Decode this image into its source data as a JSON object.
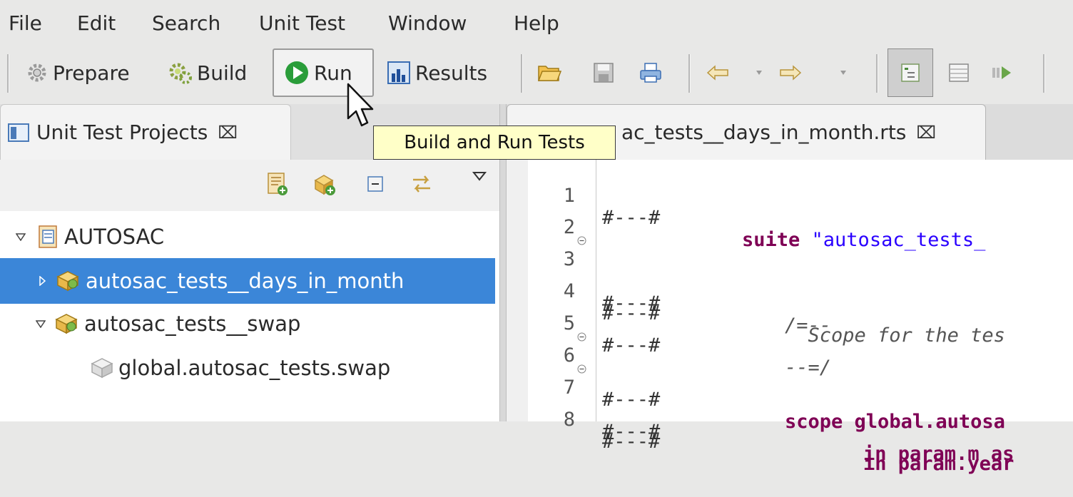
{
  "menubar": {
    "items": [
      "File",
      "Edit",
      "Search",
      "Unit Test",
      "Window",
      "Help"
    ]
  },
  "toolbar": {
    "prepare_label": "Prepare",
    "build_label": "Build",
    "run_label": "Run",
    "results_label": "Results",
    "run_color": "#2a9d3a"
  },
  "tooltip": {
    "text": "Build and Run Tests"
  },
  "left_view": {
    "tab_label": "Unit Test Projects",
    "tree": [
      {
        "label": "AUTOSAC",
        "expanded": true,
        "selected": false
      },
      {
        "label": "autosac_tests__days_in_month",
        "expanded": false,
        "selected": true
      },
      {
        "label": "autosac_tests__swap",
        "expanded": true,
        "selected": false
      },
      {
        "label": "global.autosac_tests.swap",
        "selected": false
      }
    ],
    "selection_color": "#3b86d8"
  },
  "editor": {
    "tab_label": "autosac_tests__days_in_month.rts",
    "visible_tab_label": "ac_tests__days_in_month.rts",
    "lines": [
      {
        "num": "1",
        "mark": "#---#",
        "kw": "suite",
        "rest": " \"autosac_tests_",
        "folded": false
      },
      {
        "num": "2",
        "mark": "",
        "kw": "",
        "rest": "",
        "folded": false
      },
      {
        "num": "3",
        "mark": "#---#",
        "kw": "",
        "rest": "/=--",
        "folded": true
      },
      {
        "num": "4",
        "mark": "#---#",
        "kw": "",
        "rest": "  Scope for the tes",
        "folded": false
      },
      {
        "num": "5",
        "mark": "#---#",
        "kw": "",
        "rest": "--=/",
        "folded": false
      },
      {
        "num": "6",
        "mark": "#---#",
        "kw": "scope",
        "rest": "global.autosa",
        "folded": true
      },
      {
        "num": "7",
        "mark": "#---#",
        "kw": "in",
        "rest": "param.m as",
        "folded": true
      },
      {
        "num": "8",
        "mark": "#---#",
        "kw": "in",
        "rest": "param.year",
        "folded": false
      }
    ]
  }
}
